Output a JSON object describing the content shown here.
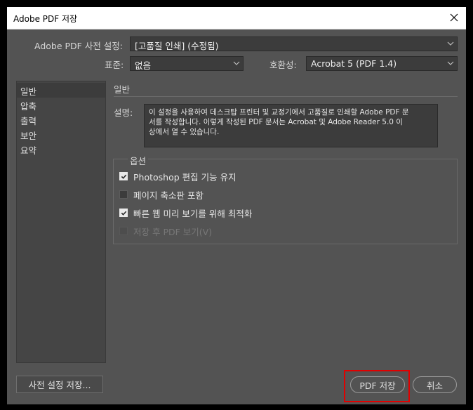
{
  "window": {
    "title": "Adobe PDF 저장"
  },
  "header": {
    "preset_label": "Adobe PDF 사전 설정:",
    "preset_value": "[고품질 인쇄] (수정됨)",
    "standard_label": "표준:",
    "standard_value": "없음",
    "compat_label": "호환성:",
    "compat_value": "Acrobat 5 (PDF 1.4)"
  },
  "sidebar": {
    "items": [
      {
        "label": "일반",
        "selected": true
      },
      {
        "label": "압축"
      },
      {
        "label": "출력"
      },
      {
        "label": "보안"
      },
      {
        "label": "요약"
      }
    ]
  },
  "general": {
    "section_title": "일반",
    "desc_label": "설명:",
    "desc_line1": "이 설정을 사용하여 데스크탑 프린터 및 교정기에서 고품질로 인쇄할 Adobe PDF 문",
    "desc_line2": "서를 작성합니다. 이렇게 작성된 PDF 문서는 Acrobat 및 Adobe Reader 5.0 이",
    "desc_line3": "상에서 열 수 있습니다."
  },
  "options": {
    "group_label": "옵션",
    "items": [
      {
        "label": "Photoshop 편집 기능 유지",
        "checked": true,
        "enabled": true
      },
      {
        "label": "페이지 축소판 포함",
        "checked": false,
        "enabled": true
      },
      {
        "label": "빠른 웹 미리 보기를 위해 최적화",
        "checked": true,
        "enabled": true
      },
      {
        "label": "저장 후 PDF 보기(V)",
        "checked": false,
        "enabled": false
      }
    ]
  },
  "footer": {
    "save_preset_label": "사전 설정 저장...",
    "save_pdf_label": "PDF 저장",
    "cancel_label": "취소"
  },
  "colors": {
    "panel": "#535353",
    "field": "#3c3c3c",
    "highlight": "#e00000"
  }
}
